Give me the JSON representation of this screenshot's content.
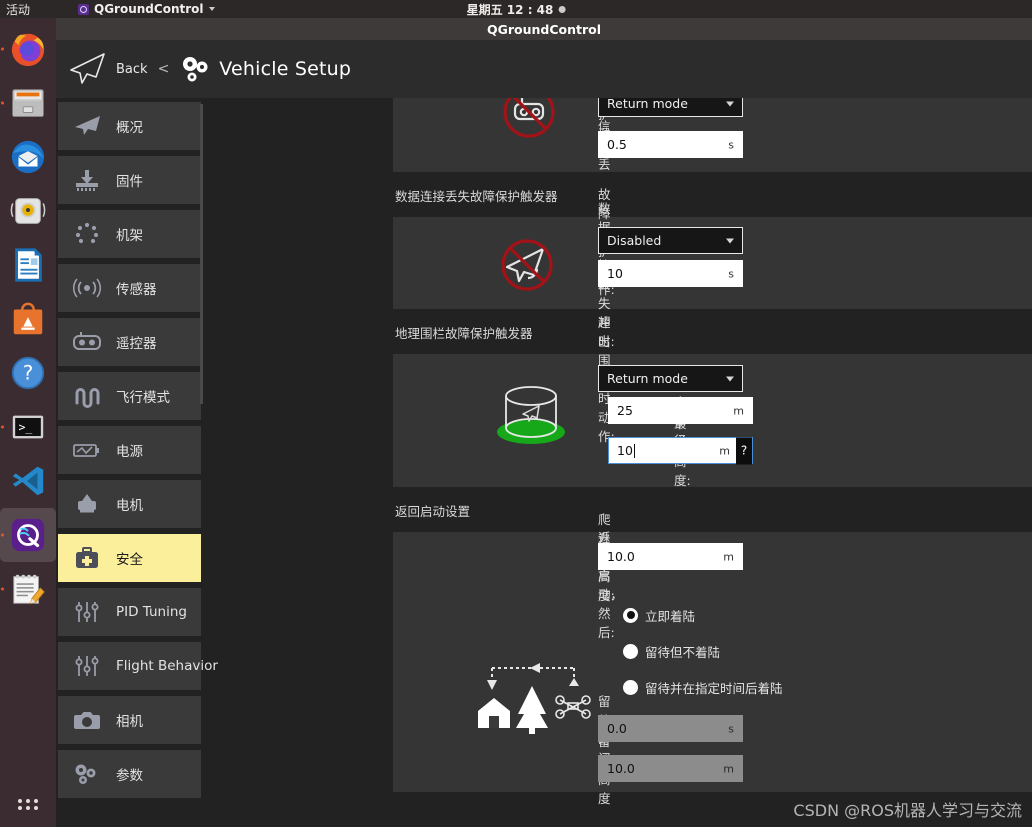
{
  "desktop": {
    "activities": "活动",
    "app_menu": "QGroundControl",
    "clock": "星期五 12 : 48",
    "dock_items": [
      {
        "name": "firefox",
        "running": true
      },
      {
        "name": "files",
        "running": true
      },
      {
        "name": "thunderbird",
        "running": false
      },
      {
        "name": "rhythmbox",
        "running": false
      },
      {
        "name": "libreoffice-writer",
        "running": false
      },
      {
        "name": "ubuntu-software",
        "running": false
      },
      {
        "name": "help",
        "running": false
      },
      {
        "name": "terminal",
        "running": true
      },
      {
        "name": "vscode",
        "running": false
      },
      {
        "name": "qgroundcontrol",
        "running": true,
        "active": true
      },
      {
        "name": "text-editor",
        "running": true
      }
    ],
    "show_apps": "show-applications"
  },
  "window": {
    "title": "QGroundControl"
  },
  "toolbar": {
    "back_label": "Back",
    "separator": "<",
    "page_title": "Vehicle Setup"
  },
  "sidebar": {
    "items": [
      {
        "label": "概况",
        "icon": "plane-icon",
        "selected": false
      },
      {
        "label": "固件",
        "icon": "firmware-icon",
        "selected": false
      },
      {
        "label": "机架",
        "icon": "airframe-icon",
        "selected": false
      },
      {
        "label": "传感器",
        "icon": "sensors-icon",
        "selected": false
      },
      {
        "label": "遥控器",
        "icon": "radio-icon",
        "selected": false
      },
      {
        "label": "飞行模式",
        "icon": "flightmodes-icon",
        "selected": false
      },
      {
        "label": "电源",
        "icon": "power-icon",
        "selected": false
      },
      {
        "label": "电机",
        "icon": "motors-icon",
        "selected": false
      },
      {
        "label": "安全",
        "icon": "safety-icon",
        "selected": true
      },
      {
        "label": "PID Tuning",
        "icon": "tuning-icon",
        "selected": false
      },
      {
        "label": "Flight Behavior",
        "icon": "tuning-icon",
        "selected": false
      },
      {
        "label": "相机",
        "icon": "camera-icon",
        "selected": false
      },
      {
        "label": "参数",
        "icon": "parameters-icon",
        "selected": false
      }
    ]
  },
  "main": {
    "rc_loss_section": {
      "icon": "rc-loss-icon",
      "failsafe_action_label": "故障保护动作:",
      "failsafe_action_value": "Return mode",
      "timeout_label": "遥控器信号丢失超时:",
      "timeout_value": "0.5",
      "timeout_unit": "s"
    },
    "datalink_section": {
      "title": "数据连接丢失故障保护触发器",
      "icon": "datalink-loss-icon",
      "failsafe_action_label": "故障保护动作:",
      "failsafe_action_value": "Disabled",
      "timeout_label": "数据连接丢失超时:",
      "timeout_value": "10",
      "timeout_unit": "s"
    },
    "geofence_section": {
      "title": "地理围栏故障保护触发器",
      "icon": "geofence-icon",
      "breach_action_label": "冲出围栏时动作:",
      "breach_action_value": "Return mode",
      "max_radius_label": "最大半径:",
      "max_radius_value": "25",
      "max_radius_unit": "m",
      "max_radius_checked": true,
      "max_altitude_label": "最大高度:",
      "max_altitude_value": "10",
      "max_altitude_unit": "m",
      "max_altitude_checked": true,
      "max_altitude_focused": true,
      "help_badge": "?"
    },
    "return_section": {
      "title": "返回启动设置",
      "icon": "return-home-icon",
      "climb_alt_label": "爬升至高度:",
      "climb_alt_value": "10.0",
      "climb_alt_unit": "m",
      "after_return_label": "返回启动，然后:",
      "options": [
        {
          "label": "立即着陆",
          "selected": true
        },
        {
          "label": "留待但不着陆",
          "selected": false
        },
        {
          "label": "留待并在指定时间后着陆",
          "selected": false
        }
      ],
      "loiter_time_label": "留待时间",
      "loiter_time_value": "0.0",
      "loiter_time_unit": "s",
      "loiter_alt_label": "留待高度",
      "loiter_alt_value": "10.0",
      "loiter_alt_unit": "m"
    }
  },
  "watermark": {
    "text": "CSDN @ROS机器人学习与交流"
  },
  "colors": {
    "accent_selected": "#fcef9b",
    "panel": "#353535",
    "background": "#222222",
    "focus_border": "#4a90d9",
    "geofence_green": "#17a81a",
    "forbidden_red": "#a31217"
  }
}
